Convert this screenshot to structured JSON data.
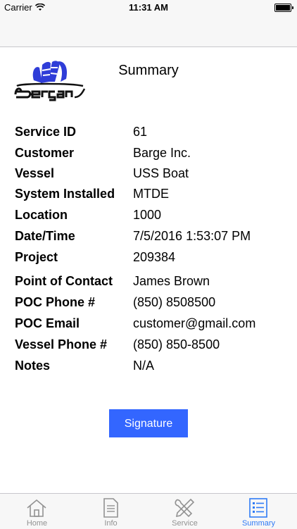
{
  "status_bar": {
    "carrier": "Carrier",
    "time": "11:31 AM"
  },
  "header": {
    "title": "Summary",
    "logo_text": "Bergan"
  },
  "details": [
    {
      "label": "Service ID",
      "value": "61"
    },
    {
      "label": "Customer",
      "value": "Barge Inc."
    },
    {
      "label": "Vessel",
      "value": "USS Boat"
    },
    {
      "label": "System Installed",
      "value": "MTDE"
    },
    {
      "label": "Location",
      "value": "1000"
    },
    {
      "label": "Date/Time",
      "value": "7/5/2016 1:53:07 PM"
    },
    {
      "label": "Project",
      "value": "209384"
    },
    {
      "label": "Point of Contact",
      "value": "James Brown"
    },
    {
      "label": "POC Phone #",
      "value": "(850) 8508500"
    },
    {
      "label": "POC Email",
      "value": "customer@gmail.com"
    },
    {
      "label": "Vessel Phone #",
      "value": "(850) 850-8500"
    },
    {
      "label": "Notes",
      "value": "N/A"
    }
  ],
  "signature_button": {
    "label": "Signature"
  },
  "tabs": [
    {
      "label": "Home",
      "icon": "home-icon",
      "active": false
    },
    {
      "label": "Info",
      "icon": "document-icon",
      "active": false
    },
    {
      "label": "Service",
      "icon": "tools-icon",
      "active": false
    },
    {
      "label": "Summary",
      "icon": "list-icon",
      "active": true
    }
  ],
  "colors": {
    "accent": "#2f7bf6",
    "button": "#3366ff",
    "logo_blue": "#2f3dd8"
  }
}
